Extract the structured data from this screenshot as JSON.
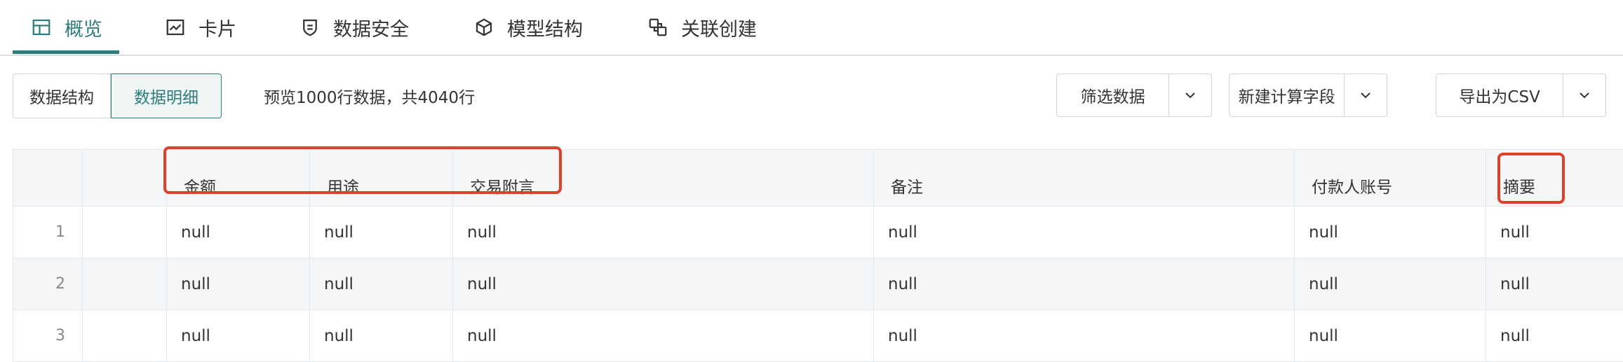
{
  "tabs": [
    {
      "label": "概览",
      "icon": "table-icon",
      "active": true
    },
    {
      "label": "卡片",
      "icon": "chart-icon",
      "active": false
    },
    {
      "label": "数据安全",
      "icon": "shield-icon",
      "active": false
    },
    {
      "label": "模型结构",
      "icon": "cube-icon",
      "active": false
    },
    {
      "label": "关联创建",
      "icon": "link-icon",
      "active": false
    }
  ],
  "toolbar": {
    "view_structure": "数据结构",
    "view_detail": "数据明细",
    "preview_text": "预览1000行数据，共4040行",
    "filter_label": "筛选数据",
    "new_field_label": "新建计算字段",
    "export_label": "导出为CSV"
  },
  "table": {
    "columns": [
      "金额",
      "用途",
      "交易附言",
      "备注",
      "付款人账号",
      "摘要"
    ],
    "rows": [
      {
        "index": "1",
        "cells": [
          "null",
          "null",
          "null",
          "null",
          "null",
          "null"
        ]
      },
      {
        "index": "2",
        "cells": [
          "null",
          "null",
          "null",
          "null",
          "null",
          "null"
        ]
      },
      {
        "index": "3",
        "cells": [
          "null",
          "null",
          "null",
          "null",
          "null",
          "null"
        ]
      }
    ]
  },
  "colors": {
    "accent": "#2f7d7b",
    "highlight": "#e0402a",
    "header_bg": "#f5f6f8",
    "border": "#e3e6ea"
  }
}
